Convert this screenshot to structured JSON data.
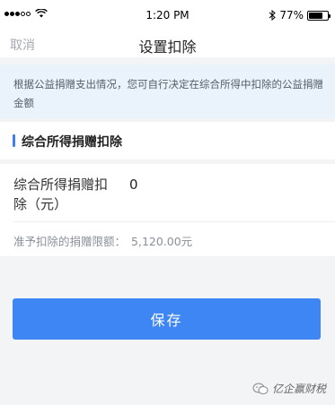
{
  "status_bar": {
    "time": "1:20 PM",
    "battery": "77%",
    "battery_level": 0.77,
    "signal_bars": 3
  },
  "nav": {
    "cancel_label": "取消",
    "title": "设置扣除"
  },
  "info_banner": {
    "text": "根据公益捐赠支出情况，您可自行决定在综合所得中扣除的公益捐赠金额"
  },
  "section": {
    "title": "综合所得捐赠扣除"
  },
  "form": {
    "deduction_label": "综合所得捐赠扣除（元）",
    "deduction_value": "0",
    "limit_label": "准予扣除的捐赠限额：",
    "limit_value": "5,120.00元"
  },
  "actions": {
    "save_label": "保存"
  },
  "watermark": {
    "text": "亿企赢财税"
  },
  "colors": {
    "accent": "#3f86f5",
    "banner_bg": "#eaf3fc",
    "page_bg": "#f3f4f6"
  }
}
